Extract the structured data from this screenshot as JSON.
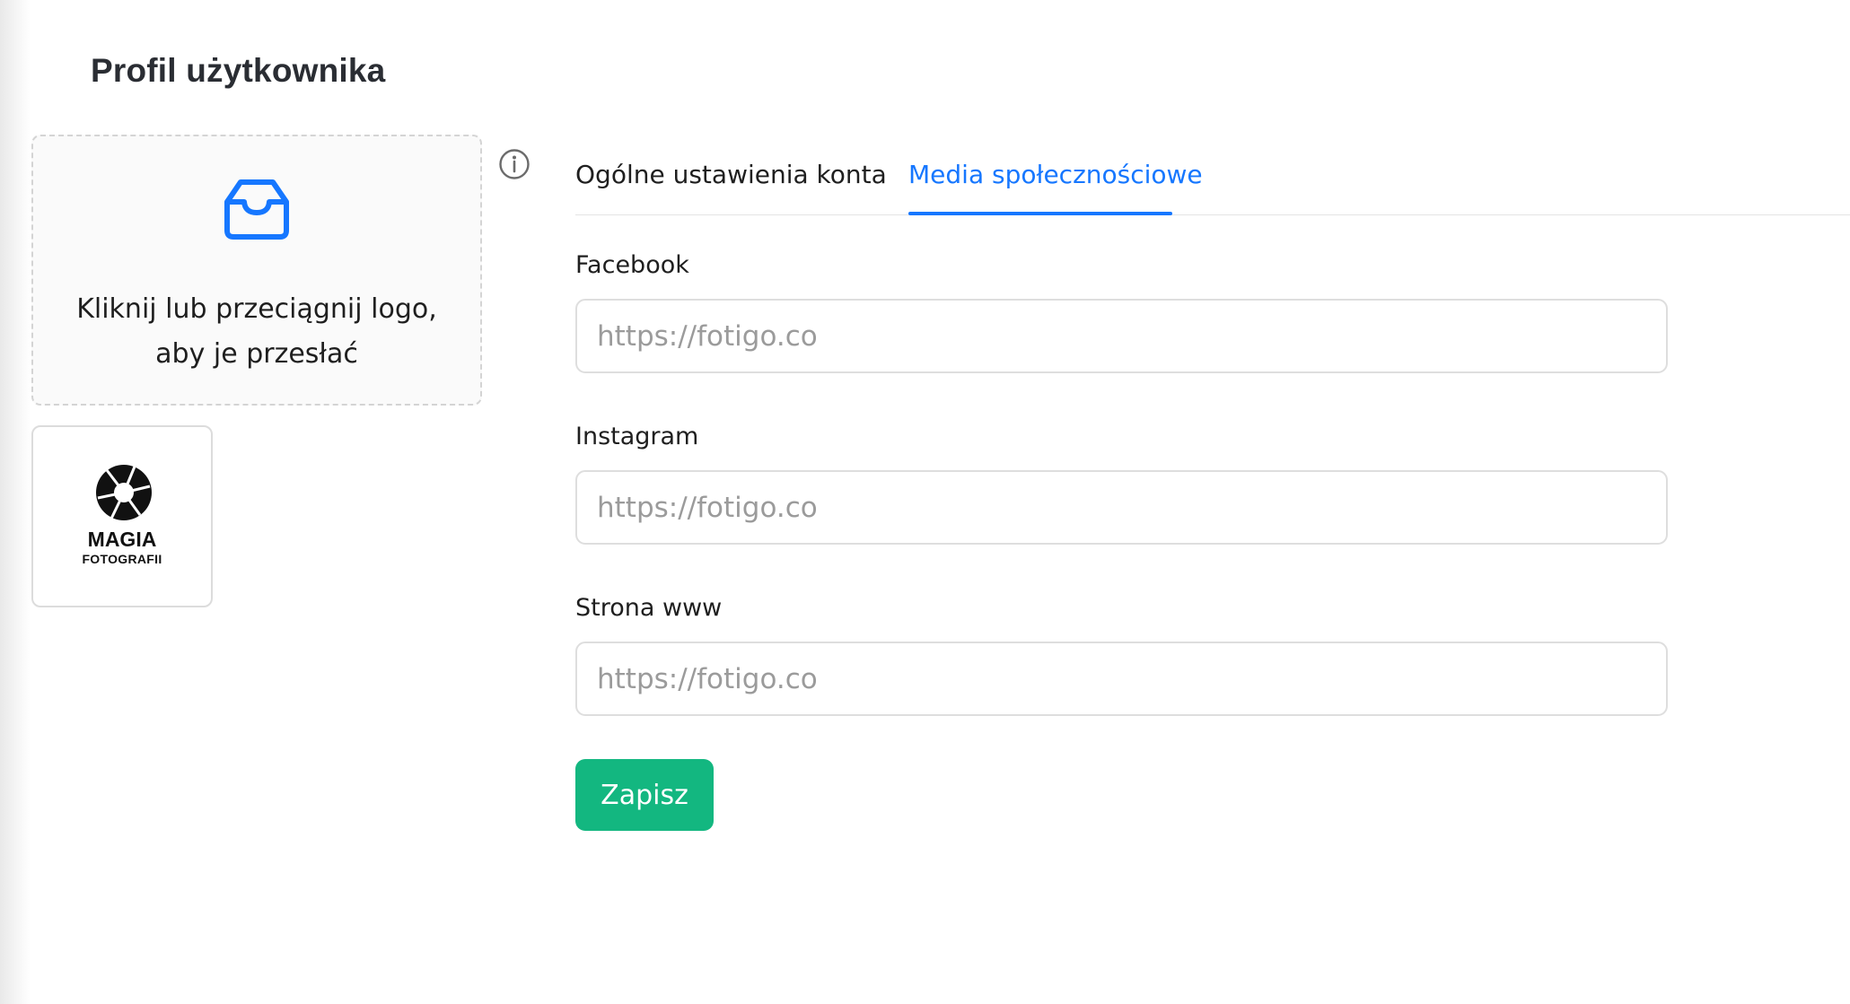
{
  "page": {
    "title": "Profil użytkownika"
  },
  "upload": {
    "icon": "inbox-icon",
    "text_line1": "Kliknij lub przeciągnij logo,",
    "text_line2": "aby je przesłać"
  },
  "info_icon": "info-circle-icon",
  "logo": {
    "name": "MAGIA",
    "subtitle": "FOTOGRAFII"
  },
  "tabs": [
    {
      "label": "Ogólne ustawienia konta",
      "active": false
    },
    {
      "label": "Media społecznościowe",
      "active": true
    }
  ],
  "form": {
    "fields": [
      {
        "label": "Facebook",
        "value": "",
        "placeholder": "https://fotigo.co"
      },
      {
        "label": "Instagram",
        "value": "",
        "placeholder": "https://fotigo.co"
      },
      {
        "label": "Strona www",
        "value": "",
        "placeholder": "https://fotigo.co"
      }
    ],
    "submit_label": "Zapisz"
  },
  "colors": {
    "accent": "#1677ff",
    "primary_button": "#13b780",
    "title_text": "#2a2d33",
    "placeholder": "#9b9b9b"
  }
}
